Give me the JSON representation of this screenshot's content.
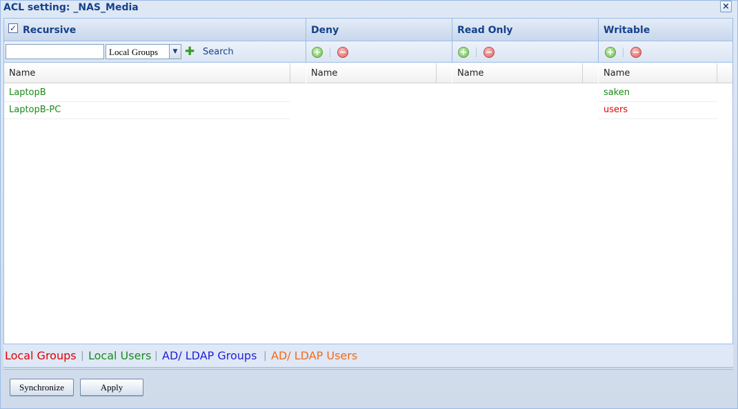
{
  "window": {
    "title": "ACL setting: _NAS_Media",
    "close_glyph": "×"
  },
  "left_panel": {
    "recursive_label": "Recursive",
    "recursive_checked": true,
    "search_value": "",
    "group_select_value": "Local Groups",
    "search_label": "Search",
    "column_header": "Name",
    "rows": [
      "LaptopB",
      "LaptopB-PC"
    ]
  },
  "deny": {
    "title": "Deny",
    "column_header": "Name",
    "rows": []
  },
  "read_only": {
    "title": "Read Only",
    "column_header": "Name",
    "rows": []
  },
  "writable": {
    "title": "Writable",
    "column_header": "Name",
    "rows": [
      {
        "label": "saken",
        "kind": "local-user"
      },
      {
        "label": "users",
        "kind": "local-group"
      }
    ]
  },
  "legend": {
    "local_groups": "Local Groups",
    "local_users": "Local Users",
    "ad_groups": "AD/ LDAP Groups",
    "ad_users": "AD/ LDAP Users",
    "separator": "|",
    "colors": {
      "local_groups": "#e00000",
      "local_users": "#1a8a1a",
      "ad_groups": "#1f1fd6",
      "ad_users": "#f06a1a"
    }
  },
  "footer": {
    "synchronize_label": "Synchronize",
    "apply_label": "Apply"
  }
}
